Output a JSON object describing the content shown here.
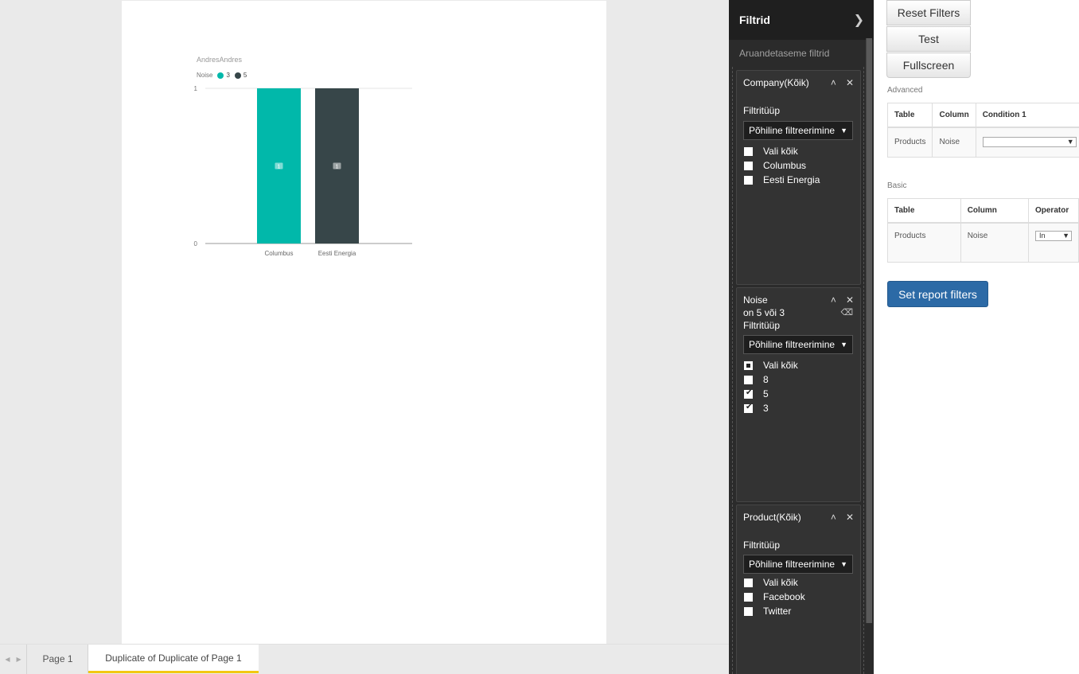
{
  "report": {
    "chart_title": "AndresAndres",
    "legend": {
      "label": "Noise",
      "items": [
        {
          "name": "3",
          "color": "#01b8aa"
        },
        {
          "name": "5",
          "color": "#374649"
        }
      ]
    }
  },
  "chart_data": {
    "type": "bar",
    "title": "AndresAndres",
    "legend_title": "Noise",
    "categories": [
      "Columbus",
      "Eesti Energia"
    ],
    "series": [
      {
        "name": "3",
        "values": [
          1,
          0
        ],
        "color": "#01b8aa"
      },
      {
        "name": "5",
        "values": [
          0,
          1
        ],
        "color": "#374649"
      }
    ],
    "data_labels": [
      "1",
      "1"
    ],
    "ylim": [
      0,
      1
    ],
    "yticks": [
      0,
      1
    ],
    "grid": true
  },
  "page_tabs": {
    "tabs": [
      {
        "label": "Page 1",
        "active": false
      },
      {
        "label": "Duplicate of Duplicate of Page 1",
        "active": true
      }
    ]
  },
  "filters": {
    "title": "Filtrid",
    "report_level_label": "Aruandetaseme filtrid",
    "cards": [
      {
        "title": "Company(Kõik)",
        "type_label": "Filtritüüp",
        "type_value": "Põhiline filtreerimine",
        "options": [
          {
            "label": "Vali kõik",
            "state": "unchecked"
          },
          {
            "label": "Columbus",
            "state": "unchecked"
          },
          {
            "label": "Eesti Energia",
            "state": "unchecked"
          }
        ]
      },
      {
        "title": "Noise",
        "subtitle": "on 5 või 3",
        "type_label": "Filtritüüp",
        "type_value": "Põhiline filtreerimine",
        "options": [
          {
            "label": "Vali kõik",
            "state": "partial"
          },
          {
            "label": "8",
            "state": "unchecked"
          },
          {
            "label": "5",
            "state": "checked"
          },
          {
            "label": "3",
            "state": "checked"
          }
        ]
      },
      {
        "title": "Product(Kõik)",
        "type_label": "Filtritüüp",
        "type_value": "Põhiline filtreerimine",
        "options": [
          {
            "label": "Vali kõik",
            "state": "unchecked"
          },
          {
            "label": "Facebook",
            "state": "unchecked"
          },
          {
            "label": "Twitter",
            "state": "unchecked"
          }
        ]
      }
    ]
  },
  "side": {
    "reset_label": "Reset Filters",
    "test_label": "Test",
    "fullscreen_label": "Fullscreen",
    "advanced_label": "Advanced",
    "advanced_table": {
      "headers": [
        "Table",
        "Column",
        "Condition 1"
      ],
      "row": [
        "Products",
        "Noise",
        ""
      ]
    },
    "basic_label": "Basic",
    "basic_table": {
      "headers": [
        "Table",
        "Column",
        "Operator"
      ],
      "row": [
        "Products",
        "Noise",
        "In"
      ]
    },
    "set_label": "Set report filters"
  }
}
